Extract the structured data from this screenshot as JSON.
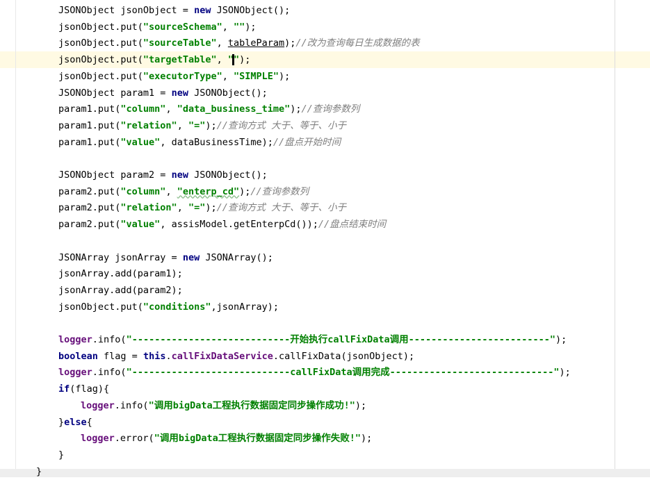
{
  "editor": {
    "lines": [
      {
        "id": "l1",
        "tokens": [
          {
            "t": "JSONObject jsonObject = ",
            "c": ""
          },
          {
            "t": "new",
            "c": "kw"
          },
          {
            "t": " JSONObject();",
            "c": ""
          }
        ]
      },
      {
        "id": "l2",
        "tokens": [
          {
            "t": "jsonObject.put(",
            "c": ""
          },
          {
            "t": "\"sourceSchema\"",
            "c": "str"
          },
          {
            "t": ", ",
            "c": ""
          },
          {
            "t": "\"\"",
            "c": "str"
          },
          {
            "t": ");",
            "c": ""
          }
        ]
      },
      {
        "id": "l3",
        "tokens": [
          {
            "t": "jsonObject.put(",
            "c": ""
          },
          {
            "t": "\"sourceTable\"",
            "c": "str"
          },
          {
            "t": ", ",
            "c": ""
          },
          {
            "t": "tableParam",
            "c": "under"
          },
          {
            "t": ");",
            "c": ""
          },
          {
            "t": "//改为查询每日生成数据的表",
            "c": "cmt"
          }
        ]
      },
      {
        "id": "l4",
        "tokens": [
          {
            "t": "jsonObject.put(",
            "c": ""
          },
          {
            "t": "\"targetTable\"",
            "c": "str"
          },
          {
            "t": ", ",
            "c": ""
          },
          {
            "t": "\"",
            "c": "str"
          },
          {
            "t": "",
            "c": "caret"
          },
          {
            "t": "\"",
            "c": "str"
          },
          {
            "t": ");",
            "c": ""
          }
        ]
      },
      {
        "id": "l5",
        "tokens": [
          {
            "t": "jsonObject.put(",
            "c": ""
          },
          {
            "t": "\"executorType\"",
            "c": "str"
          },
          {
            "t": ", ",
            "c": ""
          },
          {
            "t": "\"SIMPLE\"",
            "c": "str"
          },
          {
            "t": ");",
            "c": ""
          }
        ]
      },
      {
        "id": "l6",
        "tokens": [
          {
            "t": "JSONObject param1 = ",
            "c": ""
          },
          {
            "t": "new",
            "c": "kw"
          },
          {
            "t": " JSONObject();",
            "c": ""
          }
        ]
      },
      {
        "id": "l7",
        "tokens": [
          {
            "t": "param1.put(",
            "c": ""
          },
          {
            "t": "\"column\"",
            "c": "str"
          },
          {
            "t": ", ",
            "c": ""
          },
          {
            "t": "\"data_business_time\"",
            "c": "str"
          },
          {
            "t": ");",
            "c": ""
          },
          {
            "t": "//查询参数列",
            "c": "cmt"
          }
        ]
      },
      {
        "id": "l8",
        "tokens": [
          {
            "t": "param1.put(",
            "c": ""
          },
          {
            "t": "\"relation\"",
            "c": "str"
          },
          {
            "t": ", ",
            "c": ""
          },
          {
            "t": "\"=\"",
            "c": "str"
          },
          {
            "t": ");",
            "c": ""
          },
          {
            "t": "//查询方式 大于、等于、小于",
            "c": "cmt"
          }
        ]
      },
      {
        "id": "l9",
        "tokens": [
          {
            "t": "param1.put(",
            "c": ""
          },
          {
            "t": "\"value\"",
            "c": "str"
          },
          {
            "t": ", dataBusinessTime);",
            "c": ""
          },
          {
            "t": "//盘点开始时间",
            "c": "cmt"
          }
        ]
      },
      {
        "id": "l10",
        "tokens": []
      },
      {
        "id": "l11",
        "tokens": [
          {
            "t": "JSONObject param2 = ",
            "c": ""
          },
          {
            "t": "new",
            "c": "kw"
          },
          {
            "t": " JSONObject();",
            "c": ""
          }
        ]
      },
      {
        "id": "l12",
        "tokens": [
          {
            "t": "param2.put(",
            "c": ""
          },
          {
            "t": "\"column\"",
            "c": "str"
          },
          {
            "t": ", ",
            "c": ""
          },
          {
            "t": "\"enterp_cd\"",
            "c": "str warn"
          },
          {
            "t": ");",
            "c": ""
          },
          {
            "t": "//查询参数列",
            "c": "cmt"
          }
        ]
      },
      {
        "id": "l13",
        "tokens": [
          {
            "t": "param2.put(",
            "c": ""
          },
          {
            "t": "\"relation\"",
            "c": "str"
          },
          {
            "t": ", ",
            "c": ""
          },
          {
            "t": "\"=\"",
            "c": "str"
          },
          {
            "t": ");",
            "c": ""
          },
          {
            "t": "//查询方式 大于、等于、小于",
            "c": "cmt"
          }
        ]
      },
      {
        "id": "l14",
        "tokens": [
          {
            "t": "param2.put(",
            "c": ""
          },
          {
            "t": "\"value\"",
            "c": "str"
          },
          {
            "t": ", assisModel.getEnterpCd());",
            "c": ""
          },
          {
            "t": "//盘点结束时间",
            "c": "cmt"
          }
        ]
      },
      {
        "id": "l15",
        "tokens": []
      },
      {
        "id": "l16",
        "tokens": [
          {
            "t": "JSONArray jsonArray = ",
            "c": ""
          },
          {
            "t": "new",
            "c": "kw"
          },
          {
            "t": " JSONArray();",
            "c": ""
          }
        ]
      },
      {
        "id": "l17",
        "tokens": [
          {
            "t": "jsonArray.add(param1);",
            "c": ""
          }
        ]
      },
      {
        "id": "l18",
        "tokens": [
          {
            "t": "jsonArray.add(param2);",
            "c": ""
          }
        ]
      },
      {
        "id": "l19",
        "tokens": [
          {
            "t": "jsonObject.put(",
            "c": ""
          },
          {
            "t": "\"conditions\"",
            "c": "str"
          },
          {
            "t": ",jsonArray);",
            "c": ""
          }
        ]
      },
      {
        "id": "l20",
        "tokens": []
      },
      {
        "id": "l21",
        "tokens": [
          {
            "t": "logger",
            "c": "fldb"
          },
          {
            "t": ".info(",
            "c": ""
          },
          {
            "t": "\"----------------------------开始执行callFixData调用-------------------------\"",
            "c": "str"
          },
          {
            "t": ");",
            "c": ""
          }
        ]
      },
      {
        "id": "l22",
        "tokens": [
          {
            "t": "boolean",
            "c": "kw"
          },
          {
            "t": " flag = ",
            "c": ""
          },
          {
            "t": "this",
            "c": "kw"
          },
          {
            "t": ".",
            "c": ""
          },
          {
            "t": "callFixDataService",
            "c": "fldb"
          },
          {
            "t": ".callFixData(jsonObject);",
            "c": ""
          }
        ]
      },
      {
        "id": "l23",
        "tokens": [
          {
            "t": "logger",
            "c": "fldb"
          },
          {
            "t": ".info(",
            "c": ""
          },
          {
            "t": "\"----------------------------callFixData调用完成-----------------------------\"",
            "c": "str"
          },
          {
            "t": ");",
            "c": ""
          }
        ]
      },
      {
        "id": "l24",
        "tokens": [
          {
            "t": "if",
            "c": "kw"
          },
          {
            "t": "(flag){",
            "c": ""
          }
        ]
      },
      {
        "id": "l25",
        "indent": 1,
        "tokens": [
          {
            "t": "logger",
            "c": "fldb"
          },
          {
            "t": ".info(",
            "c": ""
          },
          {
            "t": "\"调用bigData工程执行数据固定同步操作成功!\"",
            "c": "str"
          },
          {
            "t": ");",
            "c": ""
          }
        ]
      },
      {
        "id": "l26",
        "tokens": [
          {
            "t": "}",
            "c": ""
          },
          {
            "t": "else",
            "c": "kw"
          },
          {
            "t": "{",
            "c": ""
          }
        ]
      },
      {
        "id": "l27",
        "indent": 1,
        "tokens": [
          {
            "t": "logger",
            "c": "fldb"
          },
          {
            "t": ".error(",
            "c": ""
          },
          {
            "t": "\"调用bigData工程执行数据固定同步操作失败!\"",
            "c": "str"
          },
          {
            "t": ");",
            "c": ""
          }
        ]
      },
      {
        "id": "l28",
        "tokens": [
          {
            "t": "}",
            "c": ""
          }
        ]
      },
      {
        "id": "l29",
        "indent": -1,
        "tokens": [
          {
            "t": "}",
            "c": ""
          }
        ]
      }
    ]
  }
}
